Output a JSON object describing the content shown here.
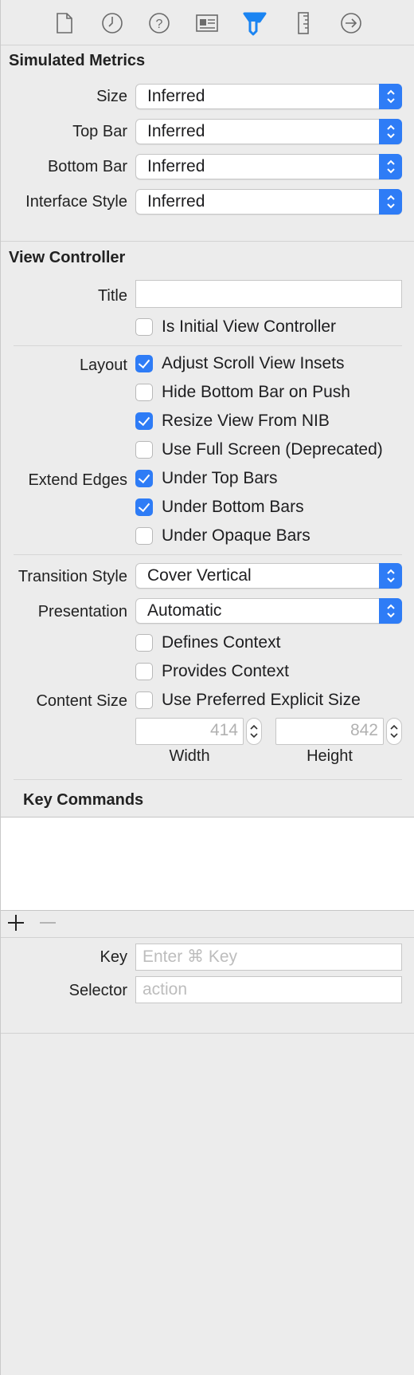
{
  "toolbar": {
    "icons": [
      "file-icon",
      "history-icon",
      "help-icon",
      "identity-icon",
      "attributes-icon",
      "size-icon",
      "connections-icon"
    ],
    "active": "attributes-icon",
    "accent": "#1a84f2"
  },
  "simulated_metrics": {
    "title": "Simulated Metrics",
    "rows": [
      {
        "label": "Size",
        "value": "Inferred"
      },
      {
        "label": "Top Bar",
        "value": "Inferred"
      },
      {
        "label": "Bottom Bar",
        "value": "Inferred"
      },
      {
        "label": "Interface Style",
        "value": "Inferred"
      }
    ]
  },
  "view_controller": {
    "title": "View Controller",
    "title_label": "Title",
    "title_value": "",
    "is_initial": {
      "label": "Is Initial View Controller",
      "checked": false
    },
    "layout_label": "Layout",
    "layout": [
      {
        "label": "Adjust Scroll View Insets",
        "checked": true
      },
      {
        "label": "Hide Bottom Bar on Push",
        "checked": false
      },
      {
        "label": "Resize View From NIB",
        "checked": true
      },
      {
        "label": "Use Full Screen (Deprecated)",
        "checked": false
      }
    ],
    "extend_edges_label": "Extend Edges",
    "extend_edges": [
      {
        "label": "Under Top Bars",
        "checked": true
      },
      {
        "label": "Under Bottom Bars",
        "checked": true
      },
      {
        "label": "Under Opaque Bars",
        "checked": false
      }
    ],
    "transition_style": {
      "label": "Transition Style",
      "value": "Cover Vertical"
    },
    "presentation": {
      "label": "Presentation",
      "value": "Automatic"
    },
    "defines_context": {
      "label": "Defines Context",
      "checked": false
    },
    "provides_context": {
      "label": "Provides Context",
      "checked": false
    },
    "content_size_label": "Content Size",
    "use_preferred": {
      "label": "Use Preferred Explicit Size",
      "checked": false
    },
    "width": {
      "value": "414",
      "label": "Width"
    },
    "height": {
      "value": "842",
      "label": "Height"
    }
  },
  "key_commands": {
    "title": "Key Commands",
    "add": "+",
    "remove": "−",
    "key_label": "Key",
    "key_placeholder": "Enter ⌘ Key",
    "selector_label": "Selector",
    "selector_placeholder": "action"
  }
}
